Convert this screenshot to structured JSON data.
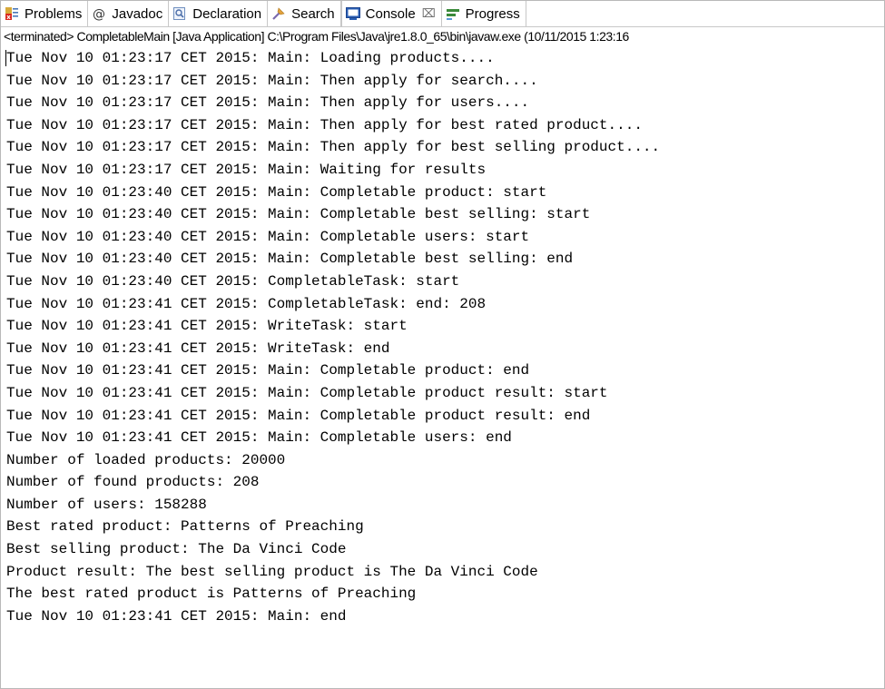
{
  "tabs": [
    {
      "label": "Problems",
      "icon": "problems-icon",
      "active": false,
      "closable": false
    },
    {
      "label": "Javadoc",
      "icon": "javadoc-icon",
      "active": false,
      "closable": false
    },
    {
      "label": "Declaration",
      "icon": "declaration-icon",
      "active": false,
      "closable": false
    },
    {
      "label": "Search",
      "icon": "search-icon",
      "active": false,
      "closable": false
    },
    {
      "label": "Console",
      "icon": "console-icon",
      "active": true,
      "closable": true,
      "close_glyph": "⌧"
    },
    {
      "label": "Progress",
      "icon": "progress-icon",
      "active": false,
      "closable": false
    }
  ],
  "process_header": "<terminated> CompletableMain [Java Application] C:\\Program Files\\Java\\jre1.8.0_65\\bin\\javaw.exe (10/11/2015 1:23:16",
  "console_lines": [
    "Tue Nov 10 01:23:17 CET 2015: Main: Loading products....",
    "Tue Nov 10 01:23:17 CET 2015: Main: Then apply for search....",
    "Tue Nov 10 01:23:17 CET 2015: Main: Then apply for users....",
    "Tue Nov 10 01:23:17 CET 2015: Main: Then apply for best rated product....",
    "Tue Nov 10 01:23:17 CET 2015: Main: Then apply for best selling product....",
    "Tue Nov 10 01:23:17 CET 2015: Main: Waiting for results",
    "Tue Nov 10 01:23:40 CET 2015: Main: Completable product: start",
    "Tue Nov 10 01:23:40 CET 2015: Main: Completable best selling: start",
    "Tue Nov 10 01:23:40 CET 2015: Main: Completable users: start",
    "Tue Nov 10 01:23:40 CET 2015: Main: Completable best selling: end",
    "Tue Nov 10 01:23:40 CET 2015: CompletableTask: start",
    "Tue Nov 10 01:23:41 CET 2015: CompletableTask: end: 208",
    "Tue Nov 10 01:23:41 CET 2015: WriteTask: start",
    "Tue Nov 10 01:23:41 CET 2015: WriteTask: end",
    "Tue Nov 10 01:23:41 CET 2015: Main: Completable product: end",
    "Tue Nov 10 01:23:41 CET 2015: Main: Completable product result: start",
    "Tue Nov 10 01:23:41 CET 2015: Main: Completable product result: end",
    "Tue Nov 10 01:23:41 CET 2015: Main: Completable users: end",
    "Number of loaded products: 20000",
    "Number of found products: 208",
    "Number of users: 158288",
    "Best rated product: Patterns of Preaching",
    "Best selling product: The Da Vinci Code",
    "Product result: The best selling product is The Da Vinci Code",
    "The best rated product is Patterns of Preaching",
    "Tue Nov 10 01:23:41 CET 2015: Main: end"
  ],
  "colors": {
    "tab_border": "#c8c8c8",
    "console_text": "#000000",
    "background": "#ffffff"
  }
}
